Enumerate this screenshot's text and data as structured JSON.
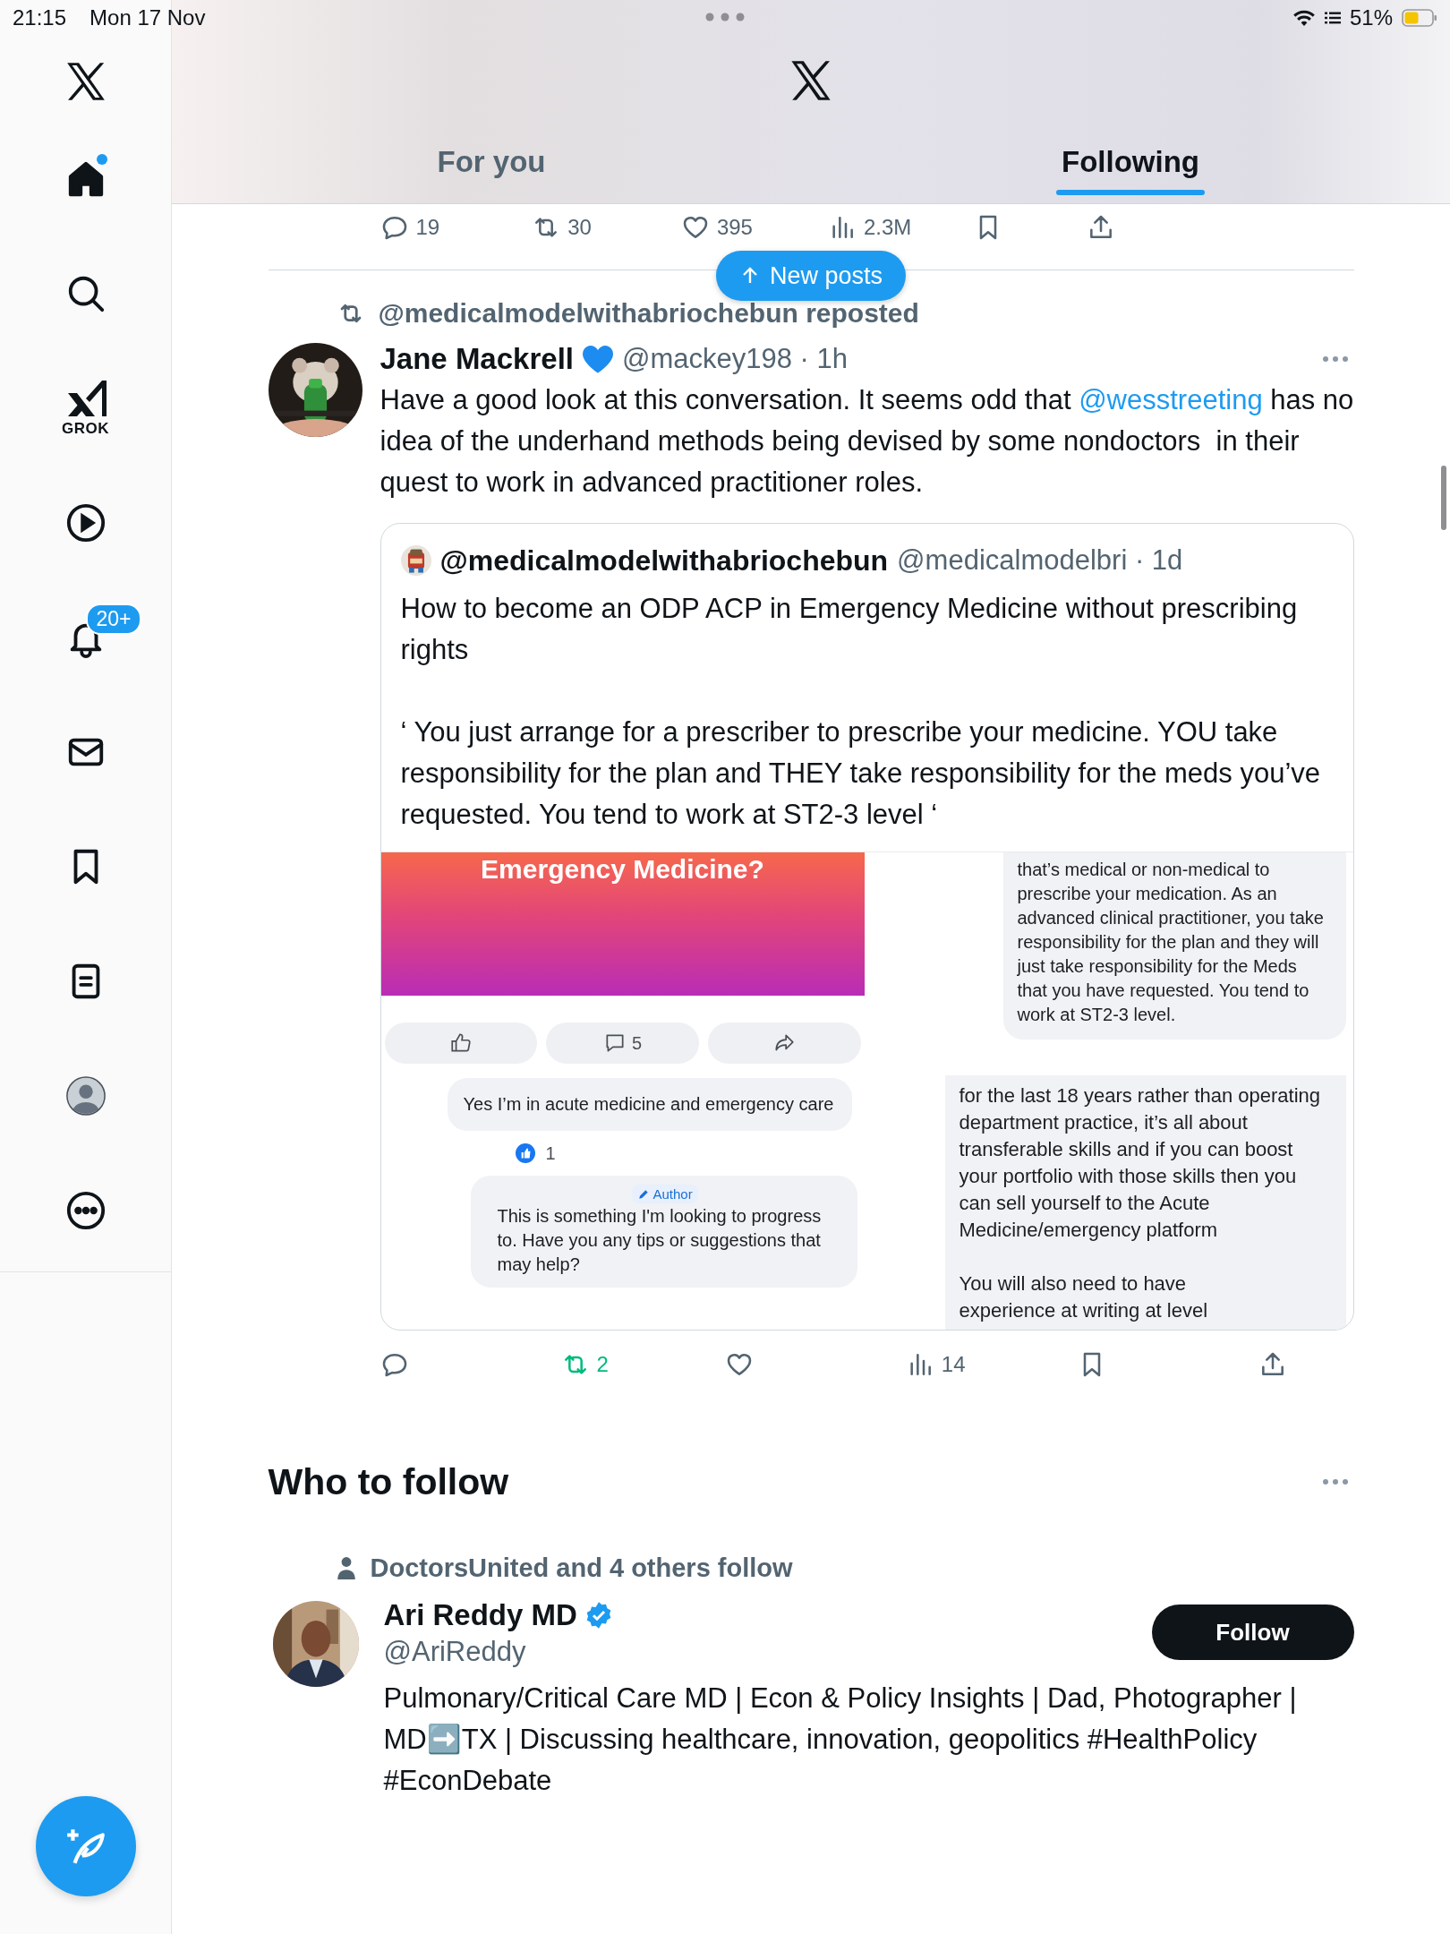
{
  "status_bar": {
    "time": "21:15",
    "date": "Mon 17 Nov",
    "battery": "51%"
  },
  "sidebar": {
    "items": [
      {
        "kind": "home",
        "selected": true,
        "unread": true
      },
      {
        "kind": "search",
        "selected": false
      },
      {
        "kind": "grok",
        "label": "GROK",
        "selected": false
      },
      {
        "kind": "video",
        "selected": false
      },
      {
        "kind": "notifications",
        "badge": "20+",
        "selected": false
      },
      {
        "kind": "messages",
        "selected": false
      },
      {
        "kind": "bookmarks",
        "selected": false
      },
      {
        "kind": "lists",
        "selected": false
      },
      {
        "kind": "profile",
        "selected": false
      },
      {
        "kind": "more",
        "selected": false
      }
    ]
  },
  "tabs": [
    {
      "label": "For you",
      "selected": false
    },
    {
      "label": "Following",
      "selected": true
    }
  ],
  "new_posts_button": "New posts",
  "previous_post_actions": {
    "replies": "19",
    "reposts": "30",
    "likes": "395",
    "views": "2.3M"
  },
  "post": {
    "repost_context": "@medicalmodelwithabriochebun reposted",
    "author": "Jane Mackrell",
    "meta": "@mackey198 · 1h",
    "text": [
      {
        "kind": "plain",
        "text": "Have a good look at this conversation. It seems odd that "
      },
      {
        "kind": "mention",
        "text": "@wesstreeting"
      },
      {
        "kind": "plain",
        "text": " has no idea of the underhand methods being devised by some nondoctors  in their quest to work in advanced practitioner roles."
      }
    ],
    "quote": {
      "author": "@medicalmodelwithabriochebun",
      "meta": "@medicalmodelbri · 1d",
      "text": "How to become an ODP ACP in Emergency Medicine without prescribing rights\n\n‘ You just arrange for a prescriber to prescribe your medicine. YOU take responsibility for the plan and THEY take responsibility for the meds you’ve requested. You tend to work at ST2-3 level ‘",
      "media_left": {
        "banner_title": "Emergency Medicine?",
        "comment_count": "5",
        "comment": "Yes I’m in acute medicine and emergency care",
        "reaction_count": "1",
        "author_badge": "Author",
        "reply": "This is something I'm looking to progress to. Have you any tips or suggestions that may help?"
      },
      "media_right": {
        "reply_top": "that’s medical or non-medical to prescribe your medication. As an advanced clinical practitioner, you take responsibility for the plan and they will just take responsibility for the Meds that you have requested. You tend to work at ST2-3 level.",
        "reply_bottom": "for the last 18 years rather than operating department practice, it’s all about transferable skills and if you can boost your portfolio with those skills then you can sell yourself to the Acute Medicine/emergency platform\n\nYou will also need to have\nexperience at writing at level"
      }
    },
    "actions": {
      "reposts": "2",
      "reposted": true,
      "views": "14"
    }
  },
  "who_to_follow": {
    "title": "Who to follow",
    "suggestions": [
      {
        "social_context": "DoctorsUnited and 4 others follow",
        "name": "Ari Reddy MD",
        "verified": true,
        "handle": "@AriReddy",
        "bio": "Pulmonary/Critical Care MD | Econ & Policy Insights | Dad, Photographer | MD➡️TX | Discussing healthcare, innovation, geopolitics #HealthPolicy #EconDebate",
        "button": "Follow"
      }
    ]
  }
}
